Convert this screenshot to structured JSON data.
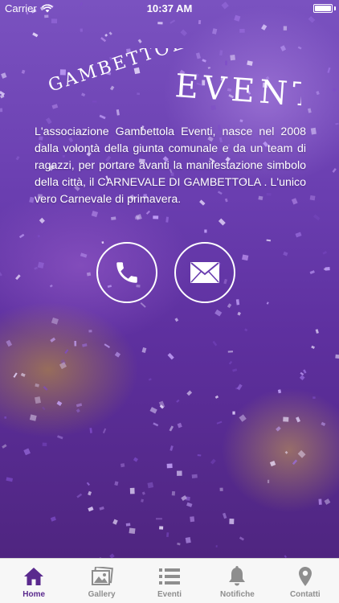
{
  "status_bar": {
    "carrier": "Carrier",
    "time": "10:37 AM"
  },
  "header": {
    "logo_line1": "GAMBETTOLA",
    "logo_line2": "EVENTI"
  },
  "intro": {
    "text": "L'associazione Gambettola Eventi, nasce nel 2008 dalla volontà della giunta comunale e da un team di ragazzi, per portare avanti la manifestazione simbolo della città, il CARNEVALE DI GAMBETTOLA . L'unico vero Carnevale di primavera."
  },
  "actions": {
    "phone_icon": "phone-icon",
    "mail_icon": "mail-icon"
  },
  "tab_bar": {
    "tabs": [
      {
        "label": "Home",
        "icon": "home-icon",
        "active": true
      },
      {
        "label": "Gallery",
        "icon": "gallery-icon",
        "active": false
      },
      {
        "label": "Eventi",
        "icon": "list-icon",
        "active": false
      },
      {
        "label": "Notifiche",
        "icon": "bell-icon",
        "active": false
      },
      {
        "label": "Contatti",
        "icon": "location-pin-icon",
        "active": false
      }
    ]
  },
  "colors": {
    "brand_purple": "#5a2a8e",
    "tab_inactive": "#8e8e8e",
    "tab_bar_bg": "#f7f7f7"
  }
}
